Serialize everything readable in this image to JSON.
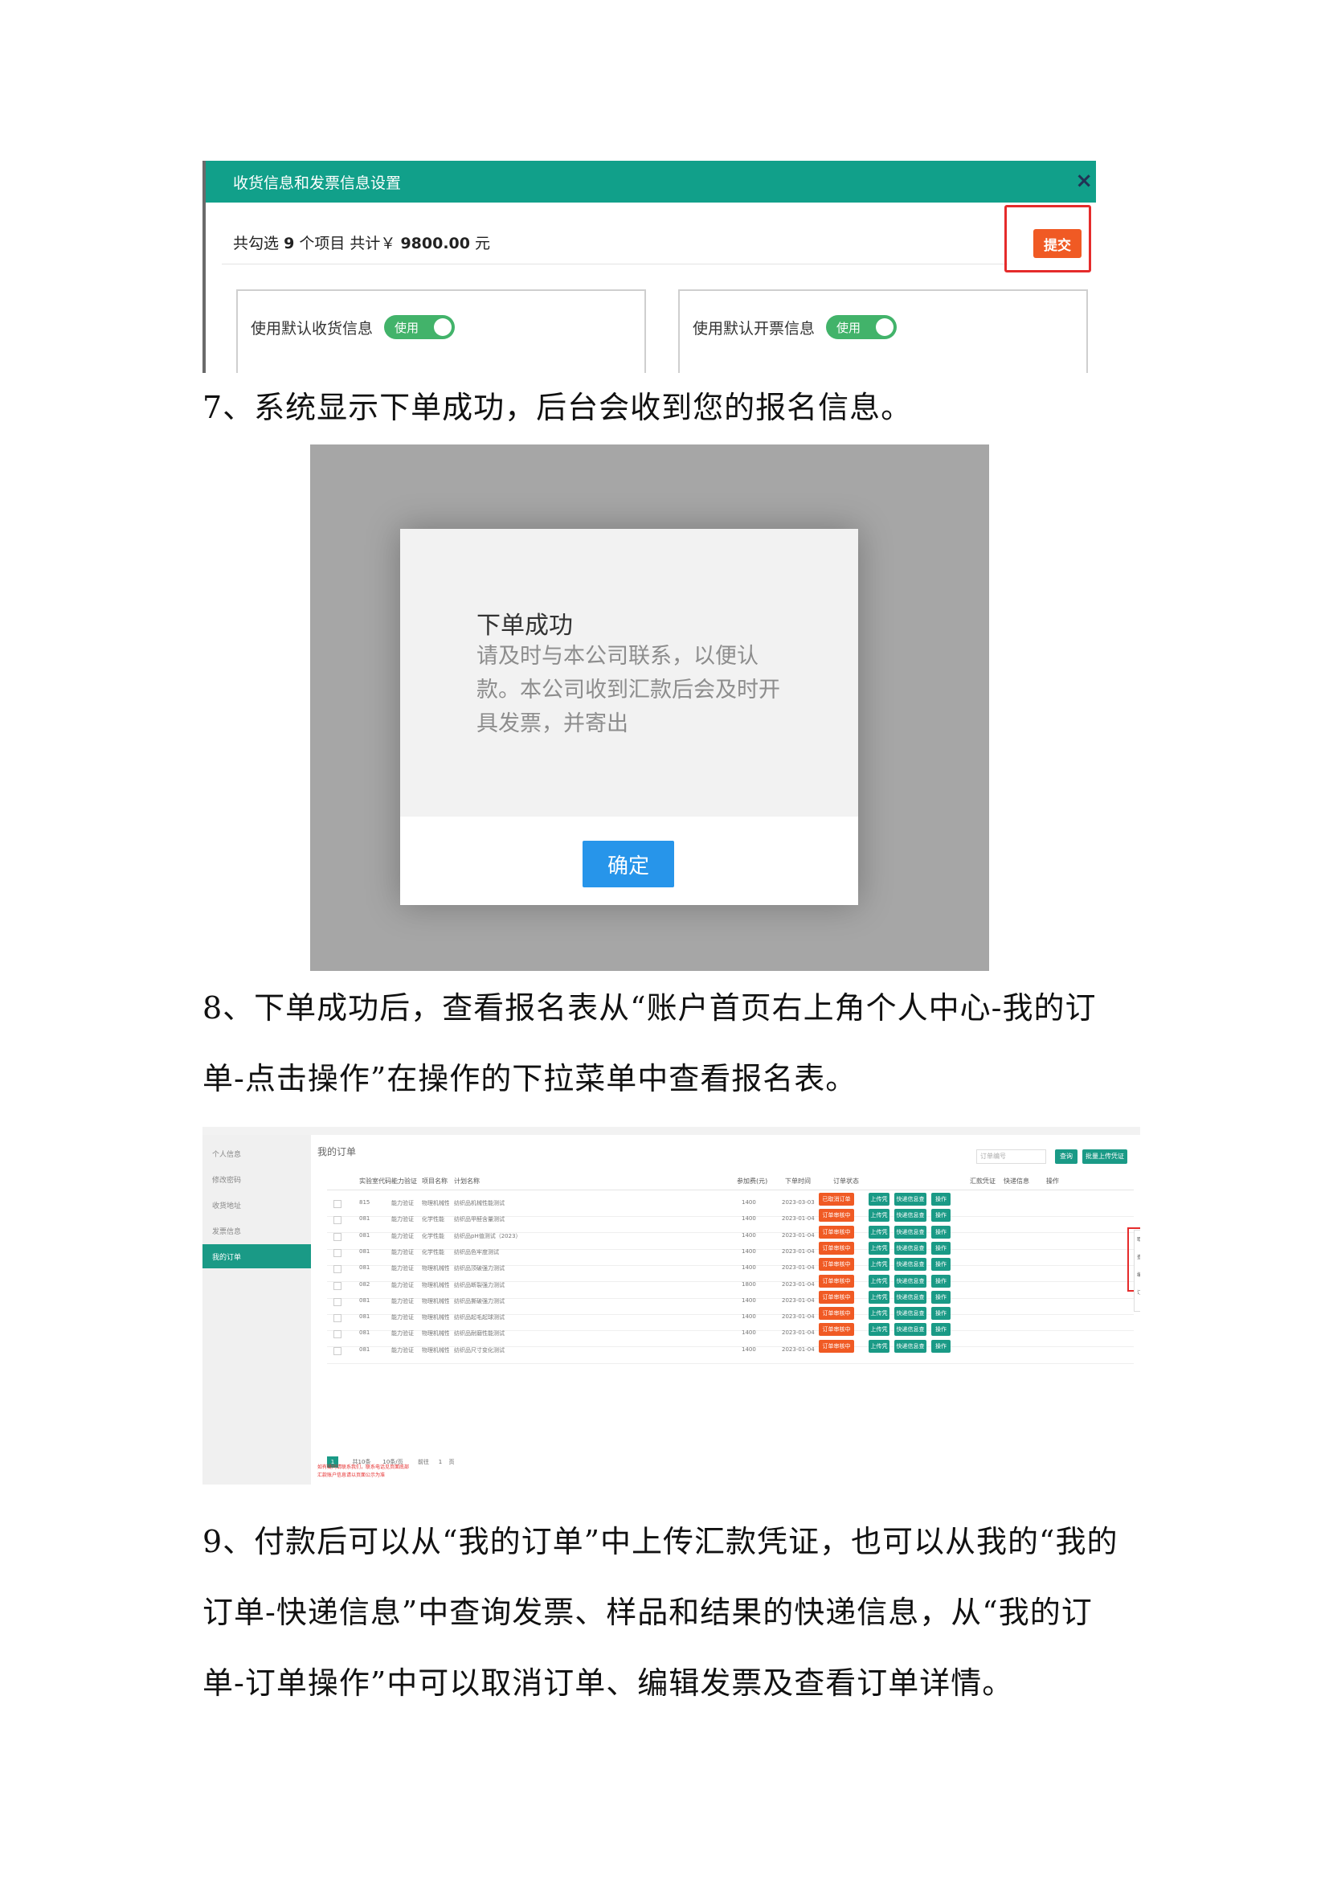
{
  "settings_dialog": {
    "title": "收货信息和发票信息设置",
    "close_icon": "×",
    "summary_prefix": "共勾选",
    "item_count": "9",
    "summary_mid": "个项目 共计￥",
    "total": "9800.00",
    "summary_unit": "元",
    "submit_label": "提交",
    "shipping_label": "使用默认收货信息",
    "invoice_label": "使用默认开票信息",
    "toggle_label": "使用"
  },
  "step7": "7、系统显示下单成功，后台会收到您的报名信息。",
  "success_modal": {
    "title": "下单成功",
    "message": "请及时与本公司联系，以便认款。本公司收到汇款后会及时开具发票，并寄出",
    "confirm_label": "确定"
  },
  "step8": "8、下单成功后，查看报名表从“账户首页右上角个人中心-我的订单-点击操作”在操作的下拉菜单中查看报名表。",
  "orders_page": {
    "page_title": "我的订单",
    "sidebar": [
      "个人信息",
      "修改密码",
      "收货地址",
      "发票信息",
      "我的订单"
    ],
    "active_sidebar_index": 4,
    "filter_placeholder": "订单编号",
    "query_label": "查询",
    "upload_batch_label": "批量上传凭证",
    "columns": [
      "实验室代码",
      "能力验证",
      "项目名称",
      "计划名称",
      "参加费(元)",
      "下单时间",
      "订单状态",
      "汇款凭证",
      "快递信息",
      "操作"
    ],
    "rows": [
      {
        "lab": "815",
        "kind": "能力验证",
        "item": "物理机械性能",
        "plan": "纺织品机械性能测试",
        "fee": "1400",
        "date": "2023-03-03",
        "status": "已取消订单"
      },
      {
        "lab": "081",
        "kind": "能力验证",
        "item": "化学性能",
        "plan": "纺织品甲醛含量测试",
        "fee": "1400",
        "date": "2023-01-04",
        "status": "订单审核中"
      },
      {
        "lab": "081",
        "kind": "能力验证",
        "item": "化学性能",
        "plan": "纺织品pH值测试（2023）",
        "fee": "1400",
        "date": "2023-01-04",
        "status": "订单审核中"
      },
      {
        "lab": "081",
        "kind": "能力验证",
        "item": "化学性能",
        "plan": "纺织品色牢度测试",
        "fee": "1400",
        "date": "2023-01-04",
        "status": "订单审核中"
      },
      {
        "lab": "081",
        "kind": "能力验证",
        "item": "物理机械性能",
        "plan": "纺织品顶破强力测试",
        "fee": "1400",
        "date": "2023-01-04",
        "status": "订单审核中"
      },
      {
        "lab": "082",
        "kind": "能力验证",
        "item": "物理机械性能",
        "plan": "纺织品断裂强力测试",
        "fee": "1800",
        "date": "2023-01-04",
        "status": "订单审核中"
      },
      {
        "lab": "081",
        "kind": "能力验证",
        "item": "物理机械性能",
        "plan": "纺织品撕破强力测试",
        "fee": "1400",
        "date": "2023-01-04",
        "status": "订单审核中"
      },
      {
        "lab": "081",
        "kind": "能力验证",
        "item": "物理机械性能",
        "plan": "纺织品起毛起球测试",
        "fee": "1400",
        "date": "2023-01-04",
        "status": "订单审核中"
      },
      {
        "lab": "081",
        "kind": "能力验证",
        "item": "物理机械性能",
        "plan": "纺织品耐磨性能测试",
        "fee": "1400",
        "date": "2023-01-04",
        "status": "订单审核中"
      },
      {
        "lab": "081",
        "kind": "能力验证",
        "item": "物理机械性能",
        "plan": "纺织品尺寸变化测试",
        "fee": "1400",
        "date": "2023-01-04",
        "status": "订单审核中"
      }
    ],
    "upload_label": "上传凭证",
    "express_label": "快递信息查询",
    "operate_label": "操作",
    "dropdown": [
      "取消订单",
      "查看报名表",
      "编辑发票",
      "订单详情"
    ],
    "pager": [
      "1",
      "共10条",
      "10条/页",
      "前往",
      "1",
      "页"
    ],
    "notes": [
      "如有疑问请联系我们，联系电话见页面底部",
      "汇款账户信息请以页面公示为准"
    ]
  },
  "step9": "9、付款后可以从“我的订单”中上传汇款凭证，也可以从我的“我的订单-快递信息”中查询发票、样品和结果的快递信息，从“我的订单-订单操作”中可以取消订单、编辑发票及查看订单详情。"
}
